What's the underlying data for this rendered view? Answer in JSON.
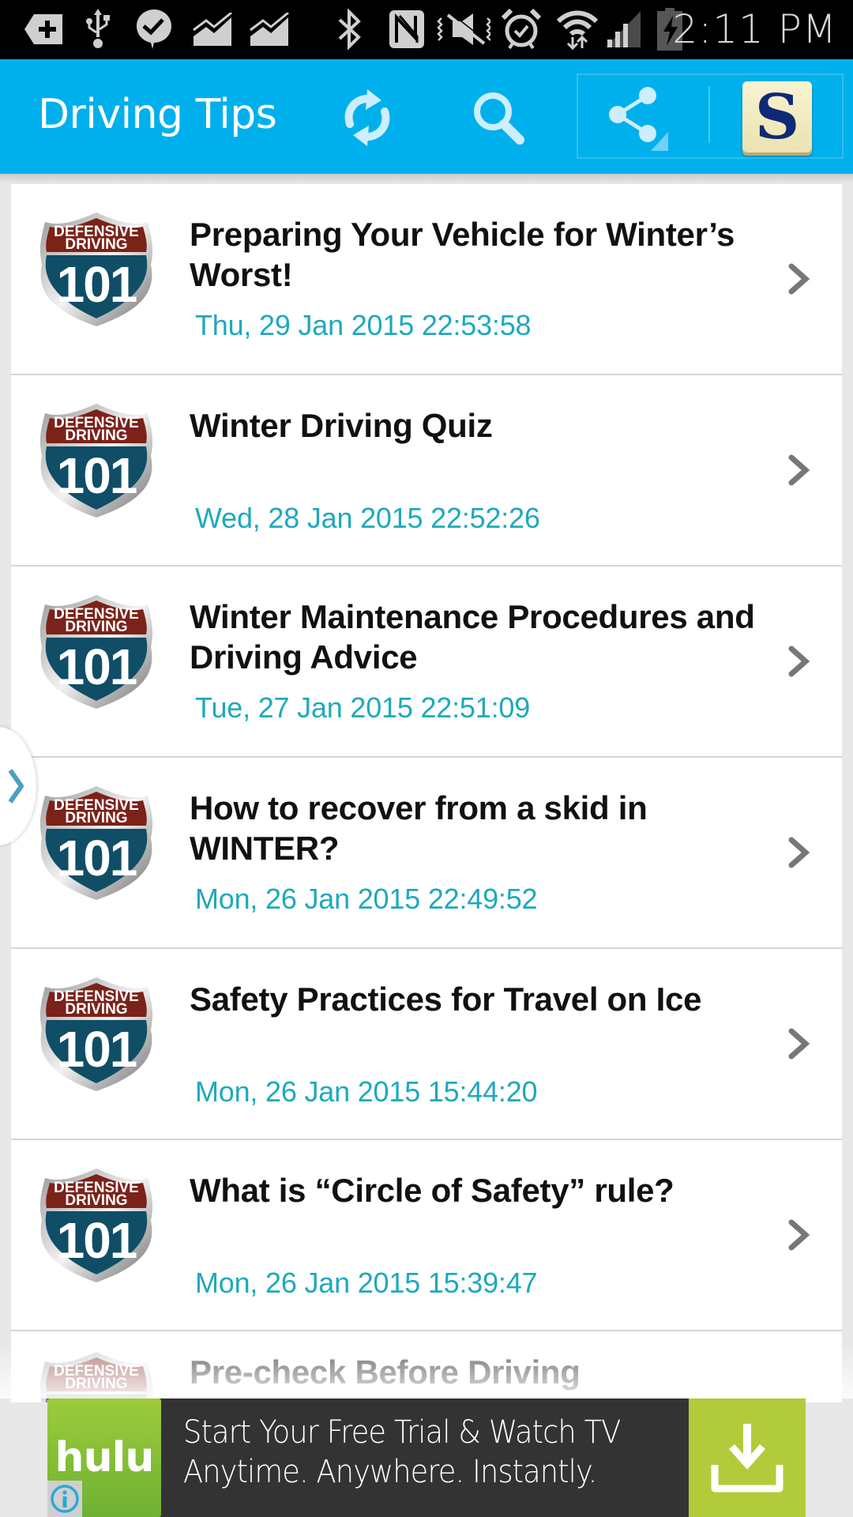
{
  "status_bar": {
    "time": "2:11 PM",
    "left_icons": [
      "add-notification-icon",
      "usb-icon",
      "messenger-check-icon",
      "stocks-chart-icon",
      "stocks-chart-icon"
    ],
    "right_icons": [
      "bluetooth-icon",
      "nfc-icon",
      "vibrate-mute-icon",
      "alarm-icon",
      "wifi-icon",
      "cell-signal-icon",
      "battery-charging-icon"
    ]
  },
  "action_bar": {
    "title": "Driving Tips",
    "actions": [
      "refresh-icon",
      "search-icon",
      "share-icon",
      "app-logo-s"
    ],
    "logo_letter": "S",
    "color": "#00b0ec"
  },
  "badge": {
    "top_text_1": "DEFENSIVE",
    "top_text_2": "DRIVING",
    "number": "101"
  },
  "articles": [
    {
      "title": "Preparing Your Vehicle for Winter’s Worst!",
      "date": "Thu, 29 Jan 2015 22:53:58"
    },
    {
      "title": "Winter Driving Quiz",
      "date": "Wed, 28 Jan 2015 22:52:26"
    },
    {
      "title": "Winter Maintenance Procedures and Driving Advice",
      "date": "Tue, 27 Jan 2015 22:51:09"
    },
    {
      "title": "How to recover from a skid in WINTER?",
      "date": "Mon, 26 Jan 2015 22:49:52"
    },
    {
      "title": "Safety Practices for Travel on Ice",
      "date": "Mon, 26 Jan 2015 15:44:20"
    },
    {
      "title": "What is “Circle of Safety” rule?",
      "date": "Mon, 26 Jan 2015 15:39:47"
    },
    {
      "title": "Pre-check Before Driving",
      "date": ""
    }
  ],
  "ad": {
    "brand": "hulu",
    "line1": "Start Your Free Trial & Watch TV",
    "line2": "Anytime. Anywhere. Instantly.",
    "brand_color": "#7ab833",
    "button_color": "#b2cb3a"
  },
  "colors": {
    "date_text": "#1ea9bd",
    "badge_red": "#7b2219",
    "badge_blue": "#0f4e66"
  }
}
